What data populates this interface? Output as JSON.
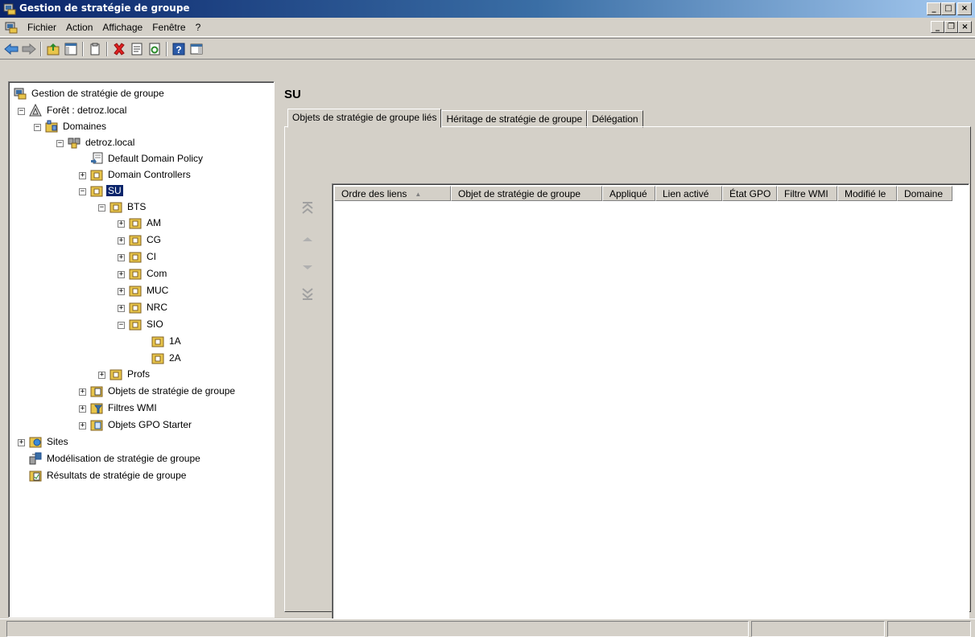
{
  "window": {
    "title": "Gestion de stratégie de groupe",
    "minimize": "_",
    "maximize": "□",
    "close": "×"
  },
  "menu": {
    "items": [
      "Fichier",
      "Action",
      "Affichage",
      "Fenêtre",
      "?"
    ],
    "mdi_minimize": "_",
    "mdi_restore": "❐",
    "mdi_close": "×"
  },
  "toolbar": {
    "buttons": [
      "back-icon",
      "forward-icon",
      "up-folder-icon",
      "show-hide-tree-icon",
      "copy-icon",
      "delete-icon",
      "properties-icon",
      "refresh-icon",
      "help-icon",
      "action-pane-icon"
    ]
  },
  "tree": {
    "root": "Gestion de stratégie de groupe",
    "forest": "Forêt : detroz.local",
    "domains": "Domaines",
    "domain": "detroz.local",
    "default_policy": "Default Domain Policy",
    "domain_controllers": "Domain Controllers",
    "su": "SU",
    "bts": "BTS",
    "am": "AM",
    "cg": "CG",
    "ci": "CI",
    "com": "Com",
    "muc": "MUC",
    "nrc": "NRC",
    "sio": "SIO",
    "sio_1a": "1A",
    "sio_2a": "2A",
    "profs": "Profs",
    "gpo_objects": "Objets de stratégie de groupe",
    "wmi_filters": "Filtres WMI",
    "starter_gpos": "Objets GPO Starter",
    "sites": "Sites",
    "modeling": "Modélisation de stratégie de groupe",
    "results": "Résultats de stratégie de groupe",
    "selected": "SU",
    "expand_plus": "+",
    "collapse_minus": "−"
  },
  "detail": {
    "title": "SU",
    "tabs": [
      "Objets de stratégie de groupe liés",
      "Héritage de stratégie de groupe",
      "Délégation"
    ],
    "active_tab": 0,
    "columns": [
      "Ordre des liens",
      "Objet de stratégie de groupe",
      "Appliqué",
      "Lien activé",
      "État GPO",
      "Filtre WMI",
      "Modifié le",
      "Domaine"
    ],
    "sort_indicator": "▲",
    "rows": []
  },
  "colors": {
    "selection": "#0a246a",
    "face": "#d4d0c8",
    "folder": "#e8c54a"
  }
}
